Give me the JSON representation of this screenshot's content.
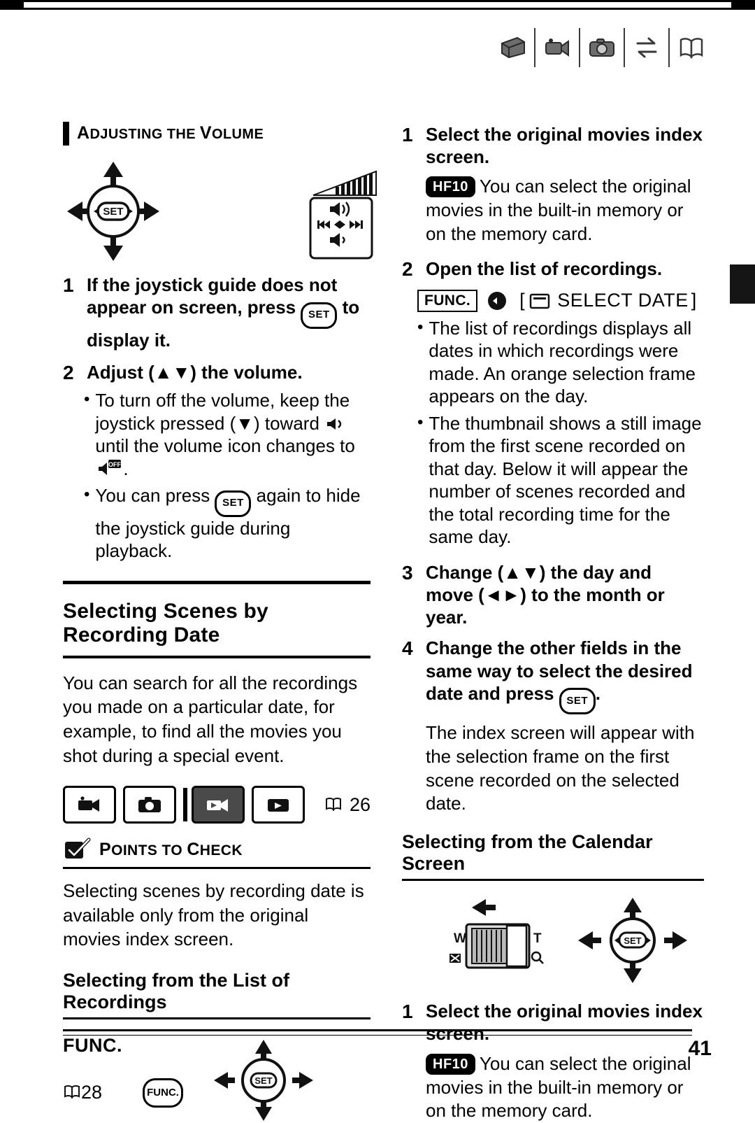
{
  "page": {
    "number": "41"
  },
  "header": {
    "icons": [
      "print-icon",
      "camcorder-icon",
      "camera-icon",
      "transfer-icon",
      "book-icon"
    ]
  },
  "left": {
    "section_heading": {
      "first": "A",
      "rest": "DJUSTING THE ",
      "first2": "V",
      "rest2": "OLUME"
    },
    "steps": [
      {
        "num": "1",
        "text_a": "If the joystick guide does not appear on screen, press ",
        "set": "SET",
        "text_b": " to display it."
      },
      {
        "num": "2",
        "text_a": "Adjust (",
        "arrows": "▲▼",
        "text_b": ") the volume."
      }
    ],
    "bullets": [
      {
        "dot": "•",
        "text_a": "To turn off the volume, keep the joystick pressed (",
        "arrow": "▼",
        "text_b": ") toward ",
        "icon": "speaker-icon",
        "text_c": " until the volume icon changes to ",
        "icon2": "speaker-off-icon",
        "text_d": "."
      },
      {
        "dot": "•",
        "text_a": "You can press ",
        "set": "SET",
        "text_b": " again to hide the joystick guide during playback."
      }
    ],
    "section_title": "Selecting Scenes by Recording Date",
    "paragraph": "You can search for all the recordings you made on a particular date, for example, to find all the movies you shot during a special event.",
    "mode_icons": [
      "movie-record-icon",
      "photo-record-icon",
      "movie-playback-icon",
      "photo-playback-icon"
    ],
    "mode_pageref": "26",
    "points_to_check": {
      "label_first": "P",
      "label_rest": "OINTS TO ",
      "label_first2": "C",
      "label_rest2": "HECK"
    },
    "ptc_text": "Selecting scenes by recording date is available only from the original movies index screen.",
    "sub_title": "Selecting from the List of Recordings",
    "func_word": "FUNC.",
    "func_pageref": "28",
    "func_button_label": "FUNC."
  },
  "right": {
    "steps": [
      {
        "num": "1",
        "text": "Select the original movies index screen."
      },
      {
        "num": "2",
        "text": "Open the list of recordings."
      },
      {
        "num": "3",
        "text_a": "Change (",
        "arrows": "▲▼",
        "text_b": ") the day and move (",
        "arrows2": "◄►",
        "text_c": ") to the month or year."
      },
      {
        "num": "4",
        "text_a": "Change the other fields in the same way to select the desired date and press ",
        "set": "SET",
        "text_b": "."
      }
    ],
    "hf10_note_1": {
      "badge": "HF10",
      "text": "You can select the original movies in the built-in memory or on the memory card."
    },
    "menu_line": {
      "func_tag": "FUNC.",
      "bracket_open": "[",
      "card_icon": "card-icon",
      "label": "SELECT DATE",
      "bracket_close": "]"
    },
    "bullets": [
      {
        "dot": "•",
        "text": "The list of recordings displays all dates in which recordings were made. An orange selection frame appears on the day."
      },
      {
        "dot": "•",
        "text": "The thumbnail shows a still image from the first scene recorded on that day. Below it will appear the number of scenes recorded and the total recording time for the same day."
      }
    ],
    "step4_note": "The index screen will appear with the selection frame on the first scene recorded on the selected date.",
    "sub_title": "Selecting from the Calendar Screen",
    "calendar_labels": {
      "w": "W",
      "t": "T"
    },
    "step_cal": {
      "num": "1",
      "text": "Select the original movies index screen."
    },
    "hf10_note_2": {
      "badge": "HF10",
      "text": "You can select the original movies in the built-in memory or on the memory card."
    }
  }
}
